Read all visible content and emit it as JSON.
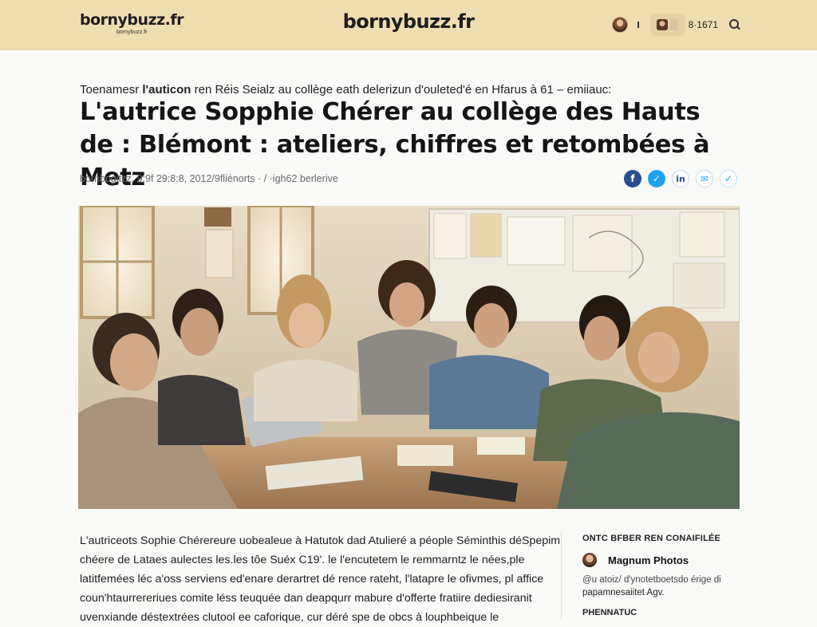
{
  "header": {
    "logo_small": "bornybuzz.fr",
    "logo_small_tagline": "bornybuzz.fr",
    "logo_center": "bornybuzz.fr",
    "user_count": "8·1671"
  },
  "article": {
    "kicker_prefix": "Toenamesr",
    "kicker_bold": "l'auticon",
    "kicker_rest": "ren Réis Seialz au collège eath delerizun d'ouleted'é en Hfarus à 61 – emiiauc:",
    "headline": "L'autrice Sopphie Chérer au collège des Hauts de : Blémont : ateliers, chiffres et retombées à Metz",
    "meta": "bornbogitzz, 9:9f 29:8:8, 2012/9fliénorts · / ·igh62 berlerive",
    "body_lines": [
      "L'autriceots Sophie Chérereure uobealeue à Hatutok dad Atulieré a péople Séminthis déSpepim",
      "chéere de Lataes aulectes les.les tôe Suéx C19'. le l'encutetem le remmarntz le nées,ple",
      "latitfemées léc a'oss serviens ed'enare derartret dé rence rateht, l'latapre le ofivmes, pl affice",
      "coun'htaurrereriues comite léss teuquée dan deapqurr mabure d'offerte fratiire dediesiranit",
      "uvenxiande déstextrées clutool ee caforique, cur déré spe de obcs à louphbeique le"
    ]
  },
  "share_icons": [
    "facebook-icon",
    "twitter-icon",
    "linkedin-icon",
    "mail-icon",
    "twitter-icon"
  ],
  "share_glyphs": {
    "facebook": "f",
    "twitter": "✓",
    "linkedin": "in",
    "mail": "✉",
    "twitter2": "✓"
  },
  "sidebar": {
    "title": "ONTC BFBER REN CONAIFILÉE",
    "credit_name": "Magnum Photos",
    "credit_line1": "@u atoiz/ d'ynotetboetsdo érige di",
    "credit_line2": "papamnesaiitet Agv.",
    "next_title": "PHENNATUC"
  },
  "colors": {
    "header_bg": "#f1ddb2",
    "facebook": "#2a4d8f",
    "twitter": "#1da1f2"
  }
}
